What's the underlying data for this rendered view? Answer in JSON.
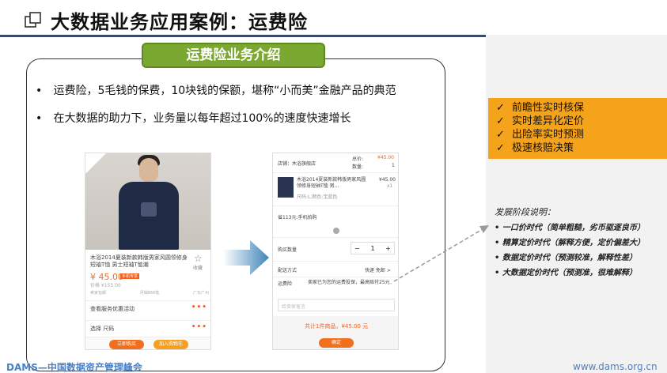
{
  "header": {
    "title": "大数据业务应用案例：运费险"
  },
  "banner": {
    "label": "运费险业务介绍"
  },
  "bullets": [
    "运费险，5毛钱的保费，10块钱的保额，堪称“小而美”金融产品的典范",
    "在大数据的助力下，业务量以每年超过100%的速度快速增长"
  ],
  "phone1": {
    "title": "木浴2014夏装新款韩版男家风圆领修身短袖T恤 男士短袖T恤潮",
    "fav_label": "收藏",
    "price": "¥ 45.00",
    "price_tag": "手机专享",
    "orig_price": "价格 ¥155.00",
    "meta": [
      "卖家包邮",
      "月销866笔",
      "广东广州"
    ],
    "row1": "查看服务优惠活动",
    "row2": "选择 尺码",
    "buy_label": "立即购买",
    "cart_label": "加入购物车"
  },
  "phone2": {
    "shop": "店铺：木浴旗舰店",
    "total_label": "总价:",
    "total_value": "¥45.00",
    "qty_label": "数量:",
    "qty_value": "1",
    "item_title": "木浴2014夏装新款韩版男家风圆领修身短袖T恤 男...",
    "item_price": "¥45.00",
    "item_qty": "x1",
    "item_spec": "尺码:L;颜色:宝蓝色",
    "saving": "省113元:手机拍购",
    "buy_qty_label": "购买数量",
    "qty_minus": "−",
    "qty_num": "1",
    "qty_plus": "+",
    "ship_label": "配送方式",
    "ship_value": "快递 免邮 >",
    "ins_label": "运费险",
    "ins_desc": "卖家已为您的运费投保，最高赔付25元",
    "msg_placeholder": "给卖家留言",
    "footer_total": "共计1件商品，¥45.00 元",
    "confirm_label": "确定"
  },
  "features": {
    "items": [
      "前瞻性实时核保",
      "实时差异化定价",
      "出险率实时预测",
      "极速核赔决策"
    ]
  },
  "stages": {
    "title": "发展阶段说明：",
    "items": [
      "一口价时代（简单粗糙，劣币驱逐良币）",
      "精算定价时代（解释方便，定价偏差大）",
      "数据定价时代（预测较准，解释性差）",
      "大数据定价时代（预测准，很难解释）"
    ]
  },
  "footer": {
    "left": "DAMS—中国数据资产管理峰会",
    "right": "www.dams.org.cn"
  },
  "colors": {
    "banner_green": "#7aa831",
    "feature_orange": "#f5a31a",
    "footer_blue": "#4a7fc7",
    "price_orange": "#f07020"
  }
}
